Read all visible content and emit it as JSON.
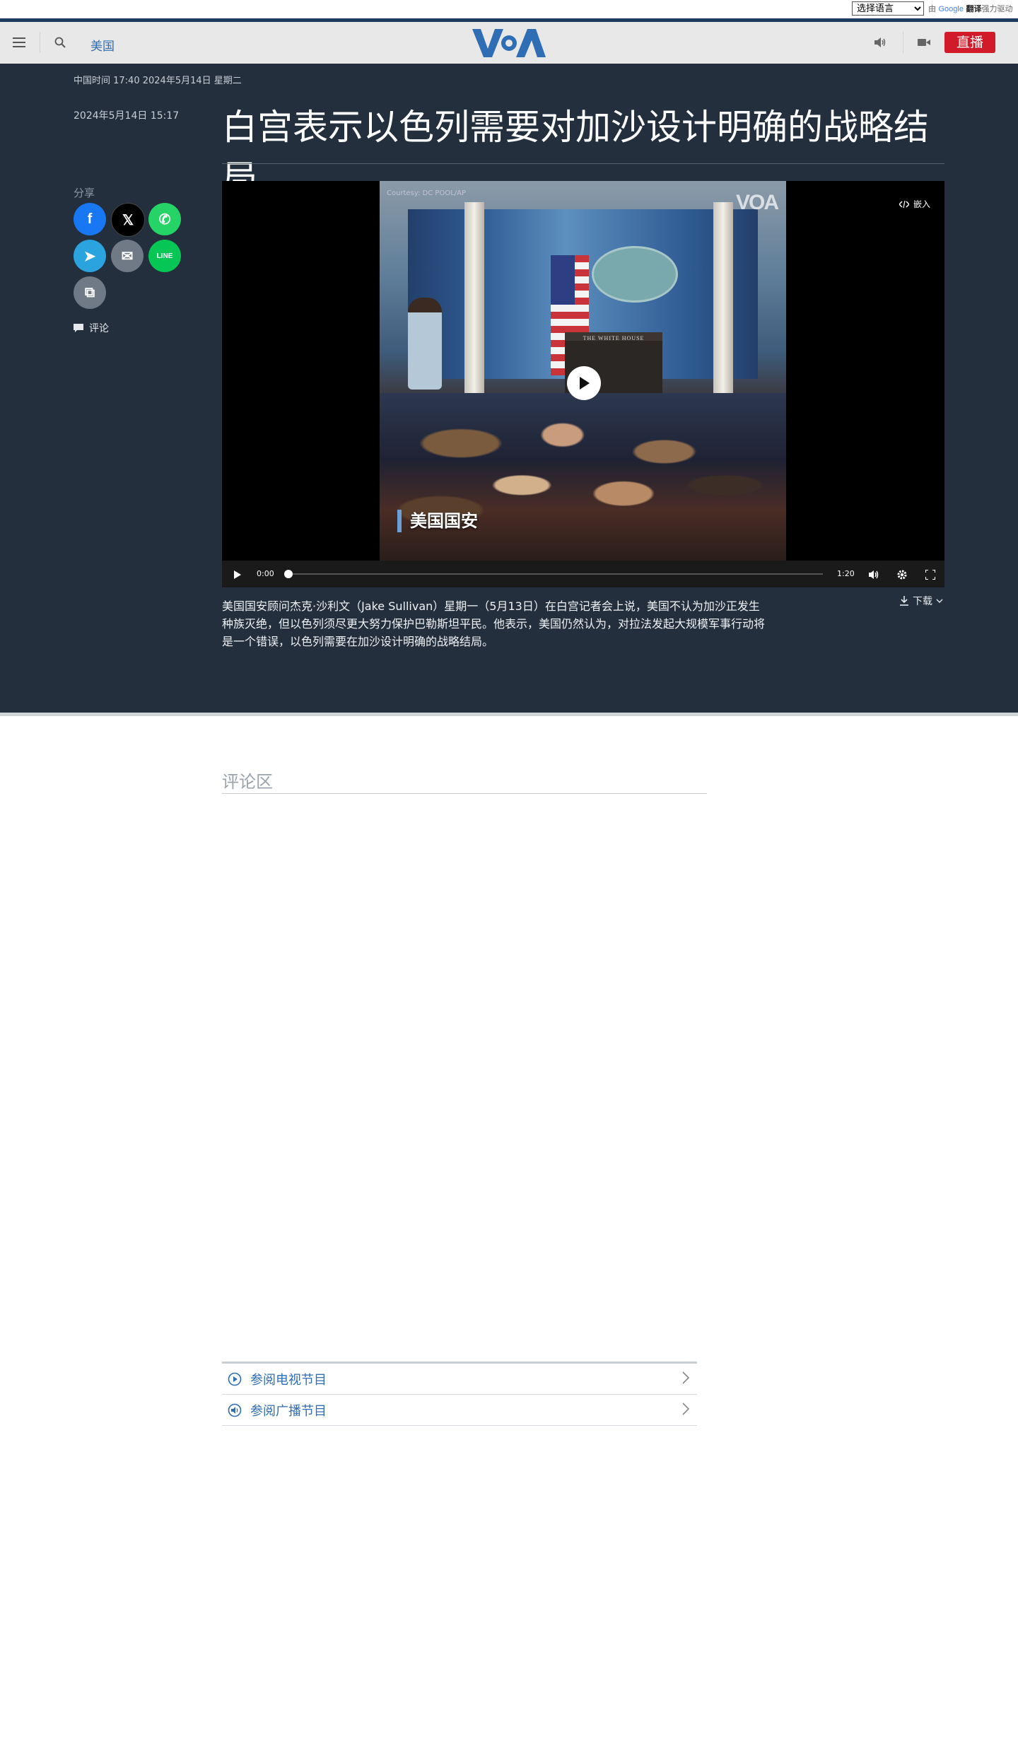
{
  "translate_bar": {
    "select_value": "选择语言",
    "powered_by_prefix": "由",
    "google": "Google",
    "translate": "翻译",
    "powered_suffix": "强力驱动"
  },
  "header": {
    "section": "美国",
    "logo_alt": "VOA",
    "live_label": "直播",
    "accent_color": "#1c3a5e",
    "live_color": "#d11a2a"
  },
  "article": {
    "timezone_time": "中国时间 17:40 2024年5月14日 星期二",
    "published": "2024年5月14日 15:17",
    "title": "白宫表示以色列需要对加沙设计明确的战略结局",
    "share_label": "分享",
    "comment_label": "评论",
    "description": "美国国安顾问杰克·沙利文（Jake Sullivan）星期一（5月13日）在白宫记者会上说，美国不认为加沙正发生种族灭绝，但以色列须尽更大努力保护巴勒斯坦平民。他表示，美国仍然认为，对拉法发起大规模军事行动将是一个错误，以色列需要在加沙设计明确的战略结局。",
    "download_label": "下载"
  },
  "share_buttons": [
    {
      "name": "facebook",
      "glyph": "f",
      "color": "#1877f2"
    },
    {
      "name": "x",
      "glyph": "𝕏",
      "color": "#000000"
    },
    {
      "name": "whatsapp",
      "glyph": "✆",
      "color": "#25d366"
    },
    {
      "name": "telegram",
      "glyph": "➤",
      "color": "#2aa3df"
    },
    {
      "name": "email",
      "glyph": "✉",
      "color": "#6f7a86"
    },
    {
      "name": "line",
      "glyph": "LINE",
      "color": "#06c755"
    },
    {
      "name": "copy-link",
      "glyph": "⧉",
      "color": "#6f7a86"
    }
  ],
  "video": {
    "courtesy": "Courtesy: DC POOL/AP",
    "watermark": "VOA",
    "caption_tag": "美国国安",
    "podium_text": "THE WHITE HOUSE",
    "embed_label": "嵌入",
    "current_time": "0:00",
    "duration": "1:20",
    "progress": 0
  },
  "comments": {
    "title": "评论区"
  },
  "programs": [
    {
      "label": "参阅电视节目",
      "icon": "play-circle-icon"
    },
    {
      "label": "参阅广播节目",
      "icon": "speaker-circle-icon"
    }
  ]
}
